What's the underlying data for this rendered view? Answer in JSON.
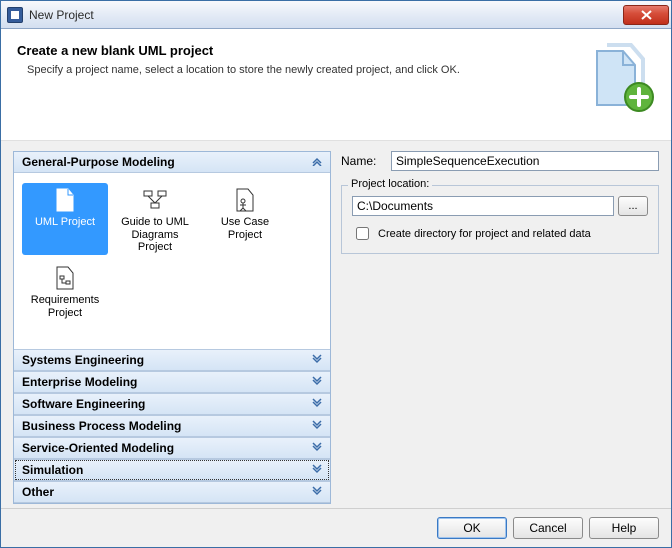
{
  "window": {
    "title": "New Project"
  },
  "header": {
    "title": "Create a new blank UML project",
    "desc": "Specify a project name, select a location to store the newly created project, and click OK."
  },
  "categories": {
    "general": "General-Purpose Modeling",
    "systems": "Systems Engineering",
    "enterprise": "Enterprise Modeling",
    "software": "Software Engineering",
    "bpm": "Business Process Modeling",
    "soa": "Service-Oriented Modeling",
    "simulation": "Simulation",
    "other": "Other"
  },
  "tiles": {
    "uml": "UML Project",
    "guide": "Guide to UML Diagrams Project",
    "usecase": "Use Case Project",
    "req": "Requirements Project"
  },
  "fields": {
    "name_label": "Name:",
    "name_value": "SimpleSequenceExecution",
    "location_legend": "Project location:",
    "location_value": "C:\\Documents",
    "browse": "...",
    "createdir": "Create directory for project and related data"
  },
  "buttons": {
    "ok": "OK",
    "cancel": "Cancel",
    "help": "Help"
  }
}
